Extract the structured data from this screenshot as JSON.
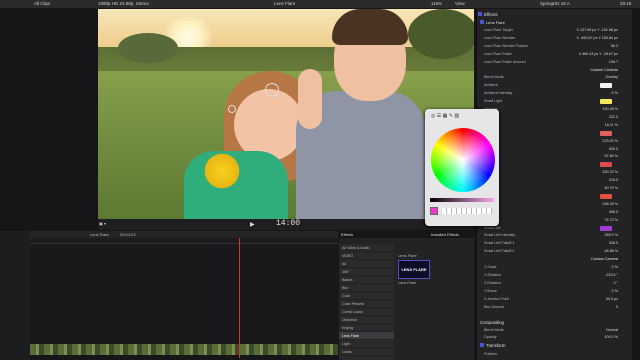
{
  "topbar": {
    "clips": "All Clips",
    "format": "1080p HD 23.98p, Stereo",
    "title": "Lens Flare",
    "zoom": "116%",
    "view": "View",
    "timecode": "SpringHD 16 A",
    "duration": "28:18"
  },
  "viewer": {
    "timecode": "14:00",
    "clip_label": "Lens Flare",
    "clip_time": "00:04:23"
  },
  "browser": {
    "header_left": "Effects",
    "header_right": "Installed Effects",
    "categories": [
      "All Video & Audio",
      "VIDEO",
      "All",
      "360°",
      "Basics",
      "Blur",
      "Color",
      "Color Presets",
      "Comic Looks",
      "Distortion",
      "Keying",
      "Lens Flare",
      "Light",
      "Looks"
    ],
    "selected": "Lens Flare",
    "thumb_text": "LENS FLARE",
    "thumb_caption": "Lens Flare"
  },
  "inspector": {
    "title": "Effects",
    "effect_name": "Lens Flare",
    "rows": [
      {
        "label": "Lens Flare Target",
        "value": "X 137.08 px  Y -151.58 px"
      },
      {
        "label": "Lens Flare Blender",
        "value": "X -490.67 px  Y 183.84 px"
      },
      {
        "label": "Lens Flare Blender Radius",
        "value": "56.3"
      },
      {
        "label": "Lens Flare Fader",
        "value": "X 460.43 px  Y -28.67 px"
      },
      {
        "label": "Lens Flare Fader Amount",
        "value": "106.7"
      },
      {
        "label": "",
        "value": "Custom Controls"
      },
      {
        "label": "Blend Mode",
        "value": "Overlay"
      },
      {
        "label": "Ambient",
        "value": ""
      },
      {
        "label": "Ambient Intensity",
        "value": "0 %"
      },
      {
        "label": "Small Light",
        "value": ""
      },
      {
        "label": "Intensity",
        "value": "100.28 %"
      },
      {
        "label": "Falloff",
        "value": "221.0"
      },
      {
        "label": "Falloff 2",
        "value": "16.11 %"
      },
      {
        "label": "Light",
        "value": ""
      },
      {
        "label": "Intensity",
        "value": "223.03 %"
      },
      {
        "label": "Falloff 1",
        "value": "630.0"
      },
      {
        "label": "Falloff 2",
        "value": "57.89 %"
      },
      {
        "label": "Light",
        "value": ""
      },
      {
        "label": "Intensity",
        "value": "300.22 %"
      },
      {
        "label": "Falloff 1",
        "value": "216.0"
      },
      {
        "label": "Falloff 2",
        "value": "60.79 %"
      },
      {
        "label": "Light",
        "value": ""
      },
      {
        "label": "Intensity",
        "value": "246.28 %"
      },
      {
        "label": "Falloff 1",
        "value": "496.0"
      },
      {
        "label": "Falloff 2",
        "value": "74.72 %"
      },
      {
        "label": "Small Left",
        "value": ""
      },
      {
        "label": "Small Left Intensity",
        "value": "289.0 %"
      },
      {
        "label": "Small Left Falloff 1",
        "value": "328.0"
      },
      {
        "label": "Small Left Falloff 2",
        "value": "48.88 %"
      },
      {
        "label": "",
        "value": "Custom Camera"
      },
      {
        "label": "Z.Scale",
        "value": "0 %"
      },
      {
        "label": "X.Rotation",
        "value": "-133.0 °"
      },
      {
        "label": "Z.Rotation",
        "value": "0 °"
      },
      {
        "label": "Y.Shear",
        "value": "0 %"
      },
      {
        "label": "X.Anchor Point",
        "value": "50.0 px"
      },
      {
        "label": "Blur Amount",
        "value": "0"
      }
    ],
    "compositing": "Compositing",
    "blend_mode_label": "Blend Mode",
    "blend_mode": "Normal",
    "opacity_label": "Opacity",
    "opacity": "100.0 %",
    "transform": "Transform",
    "position": "Position"
  },
  "swatch_colors": [
    "#f2f2f2",
    "#f4e85a",
    "#e06060",
    "#e04c4c",
    "#e4503c",
    "#a13cd0",
    "#f0508a",
    "#c840d8",
    "#d838c8"
  ],
  "colors": {
    "accent": "#4a55d6",
    "playhead": "#dd3333"
  }
}
